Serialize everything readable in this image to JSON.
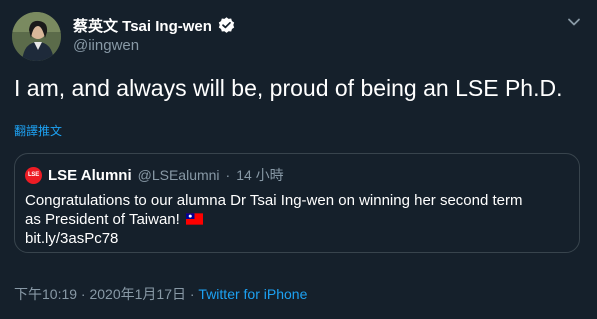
{
  "author": {
    "display_name": "蔡英文 Tsai Ing-wen",
    "handle": "@iingwen",
    "verified_icon": "verified-badge-icon"
  },
  "tweet": {
    "text": "I am, and always will be, proud of being an LSE Ph.D.",
    "translate_label": "翻譯推文"
  },
  "quoted_tweet": {
    "logo_text": "LSE",
    "name": "LSE Alumni",
    "handle": "@LSEalumni",
    "separator": "·",
    "time": "14 小時",
    "line1": "Congratulations to our alumna Dr Tsai Ing-wen on winning her second term",
    "line2": "as President of Taiwan!",
    "link": "bit.ly/3asPc78",
    "flag_icon": "taiwan-flag-icon"
  },
  "footer": {
    "timestamp": "下午10:19 · 2020年1月17日 · ",
    "source": "Twitter for iPhone"
  },
  "colors": {
    "background": "#15202b",
    "text": "#ffffff",
    "secondary": "#8899a6",
    "accent": "#1da1f2",
    "border": "#38444d"
  }
}
